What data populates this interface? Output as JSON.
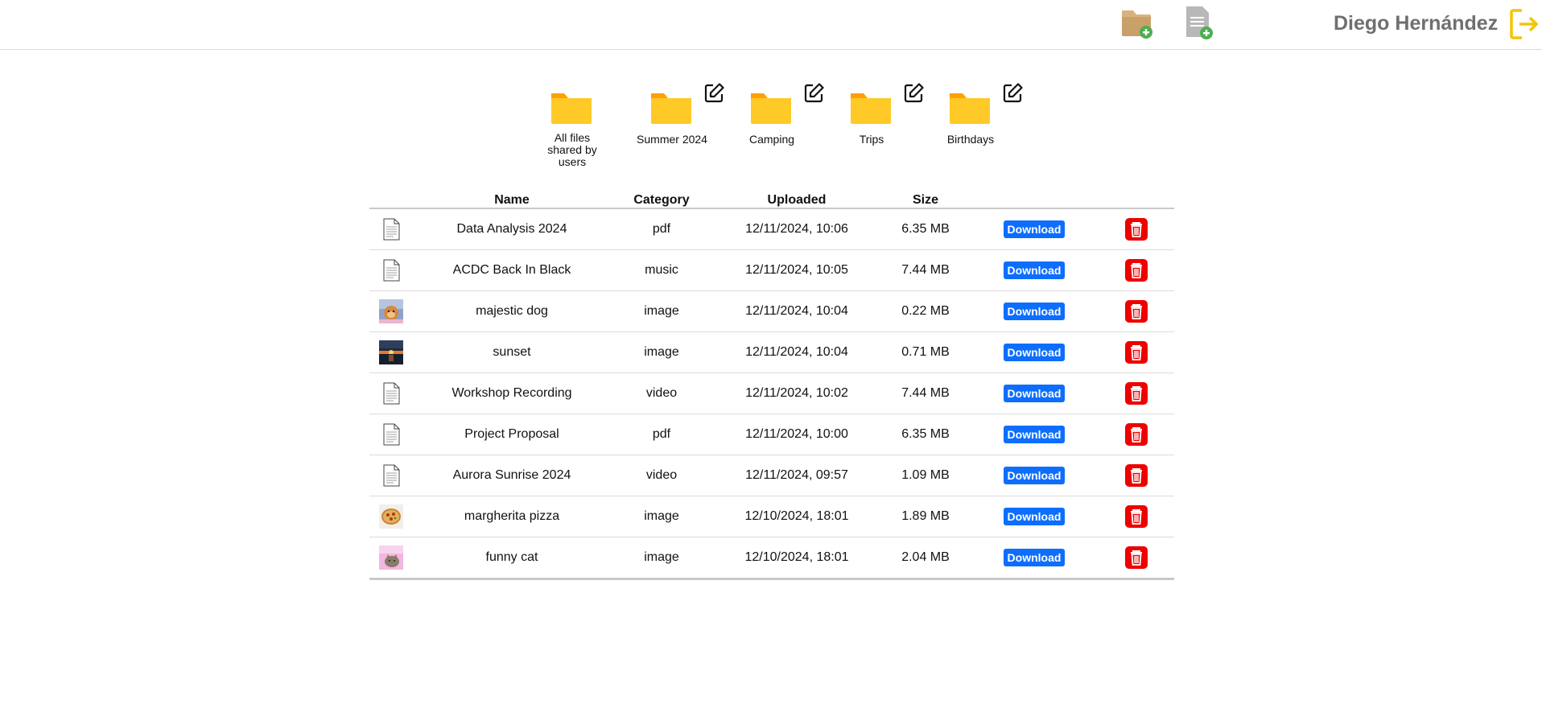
{
  "header": {
    "user_name": "Diego Hernández",
    "new_folder_icon": "folder-plus-icon",
    "new_file_icon": "file-plus-icon",
    "logout_icon": "logout-icon"
  },
  "folders": [
    {
      "label": "All files shared by users",
      "editable": false
    },
    {
      "label": "Summer 2024",
      "editable": true
    },
    {
      "label": "Camping",
      "editable": true
    },
    {
      "label": "Trips",
      "editable": true
    },
    {
      "label": "Birthdays",
      "editable": true
    }
  ],
  "table": {
    "headers": [
      "",
      "Name",
      "Category",
      "Uploaded",
      "Size",
      "",
      ""
    ],
    "download_label": "Download",
    "rows": [
      {
        "thumb": "document-icon",
        "name": "Data Analysis 2024",
        "category": "pdf",
        "uploaded": "12/11/2024, 10:06",
        "size": "6.35 MB"
      },
      {
        "thumb": "document-icon",
        "name": "ACDC Back In Black",
        "category": "music",
        "uploaded": "12/11/2024, 10:05",
        "size": "7.44 MB"
      },
      {
        "thumb": "dog-thumbnail",
        "name": "majestic dog",
        "category": "image",
        "uploaded": "12/11/2024, 10:04",
        "size": "0.22 MB"
      },
      {
        "thumb": "sunset-thumbnail",
        "name": "sunset",
        "category": "image",
        "uploaded": "12/11/2024, 10:04",
        "size": "0.71 MB"
      },
      {
        "thumb": "document-icon",
        "name": "Workshop Recording",
        "category": "video",
        "uploaded": "12/11/2024, 10:02",
        "size": "7.44 MB"
      },
      {
        "thumb": "document-icon",
        "name": "Project Proposal",
        "category": "pdf",
        "uploaded": "12/11/2024, 10:00",
        "size": "6.35 MB"
      },
      {
        "thumb": "document-icon",
        "name": "Aurora Sunrise 2024",
        "category": "video",
        "uploaded": "12/11/2024, 09:57",
        "size": "1.09 MB"
      },
      {
        "thumb": "pizza-thumbnail",
        "name": "margherita pizza",
        "category": "image",
        "uploaded": "12/10/2024, 18:01",
        "size": "1.89 MB"
      },
      {
        "thumb": "cat-thumbnail",
        "name": "funny cat",
        "category": "image",
        "uploaded": "12/10/2024, 18:01",
        "size": "2.04 MB"
      }
    ]
  },
  "colors": {
    "folder": "#FFC928",
    "folder_tab": "#FFA000",
    "download_button": "#0D6EFD",
    "delete_button": "#EE0000",
    "logout": "#F5C400",
    "user_name": "#6F6F6F"
  }
}
